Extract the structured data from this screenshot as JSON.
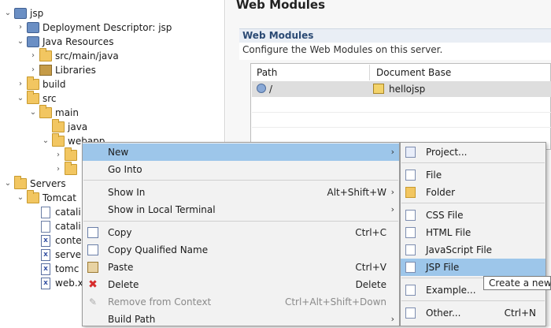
{
  "tree": [
    {
      "label": "jsp",
      "twisty": "⌄",
      "icon": "project-icon",
      "indent": 0
    },
    {
      "label": "Deployment Descriptor: jsp",
      "twisty": "›",
      "icon": "descriptor-icon",
      "indent": 1
    },
    {
      "label": "Java Resources",
      "twisty": "⌄",
      "icon": "java-resources-icon",
      "indent": 1
    },
    {
      "label": "src/main/java",
      "twisty": "›",
      "icon": "source-folder-icon",
      "indent": 2
    },
    {
      "label": "Libraries",
      "twisty": "›",
      "icon": "library-icon",
      "indent": 2
    },
    {
      "label": "build",
      "twisty": "›",
      "icon": "folder-icon",
      "indent": 1
    },
    {
      "label": "src",
      "twisty": "⌄",
      "icon": "folder-icon",
      "indent": 1
    },
    {
      "label": "main",
      "twisty": "⌄",
      "icon": "folder-icon",
      "indent": 2
    },
    {
      "label": "java",
      "twisty": "",
      "icon": "folder-icon",
      "indent": 3
    },
    {
      "label": "webapp",
      "twisty": "⌄",
      "icon": "folder-icon",
      "indent": 3
    },
    {
      "label": "",
      "twisty": "›",
      "icon": "folder-icon",
      "indent": 4
    },
    {
      "label": "",
      "twisty": "›",
      "icon": "folder-icon",
      "indent": 4
    },
    {
      "label": "Servers",
      "twisty": "⌄",
      "icon": "folder-icon",
      "indent": 0
    },
    {
      "label": "Tomcat",
      "twisty": "⌄",
      "icon": "folder-icon",
      "indent": 1
    },
    {
      "label": "catali",
      "twisty": "",
      "icon": "file-icon",
      "indent": 2
    },
    {
      "label": "catali",
      "twisty": "",
      "icon": "file-icon",
      "indent": 2
    },
    {
      "label": "conte",
      "twisty": "",
      "icon": "xml-file-icon",
      "indent": 2
    },
    {
      "label": "serve",
      "twisty": "",
      "icon": "xml-file-icon",
      "indent": 2
    },
    {
      "label": "tomc",
      "twisty": "",
      "icon": "xml-file-icon",
      "indent": 2
    },
    {
      "label": "web.x",
      "twisty": "",
      "icon": "xml-file-icon",
      "indent": 2
    }
  ],
  "editor": {
    "title": "Web Modules",
    "section_title": "Web Modules",
    "section_desc": "Configure the Web Modules on this server.",
    "col_path": "Path",
    "col_docbase": "Document Base",
    "row_path": "/",
    "row_docbase": "hellojsp"
  },
  "menu": {
    "new": "New",
    "go_into": "Go Into",
    "show_in": "Show In",
    "show_in_accel": "Alt+Shift+W",
    "show_in_terminal": "Show in Local Terminal",
    "copy": "Copy",
    "copy_accel": "Ctrl+C",
    "copy_qualified": "Copy Qualified Name",
    "paste": "Paste",
    "paste_accel": "Ctrl+V",
    "delete": "Delete",
    "delete_accel": "Delete",
    "remove_context": "Remove from Context",
    "remove_context_accel": "Ctrl+Alt+Shift+Down",
    "build_path": "Build Path"
  },
  "submenu": {
    "project": "Project...",
    "file": "File",
    "folder": "Folder",
    "css_file": "CSS File",
    "html_file": "HTML File",
    "js_file": "JavaScript File",
    "jsp_file": "JSP File",
    "example": "Example...",
    "other": "Other...",
    "other_accel": "Ctrl+N"
  },
  "tooltip": "Create a new JSP",
  "colors": {
    "highlight": "#9dc6ea",
    "menu_bg": "#f2f2f2",
    "section_head": "#2b4a74"
  }
}
